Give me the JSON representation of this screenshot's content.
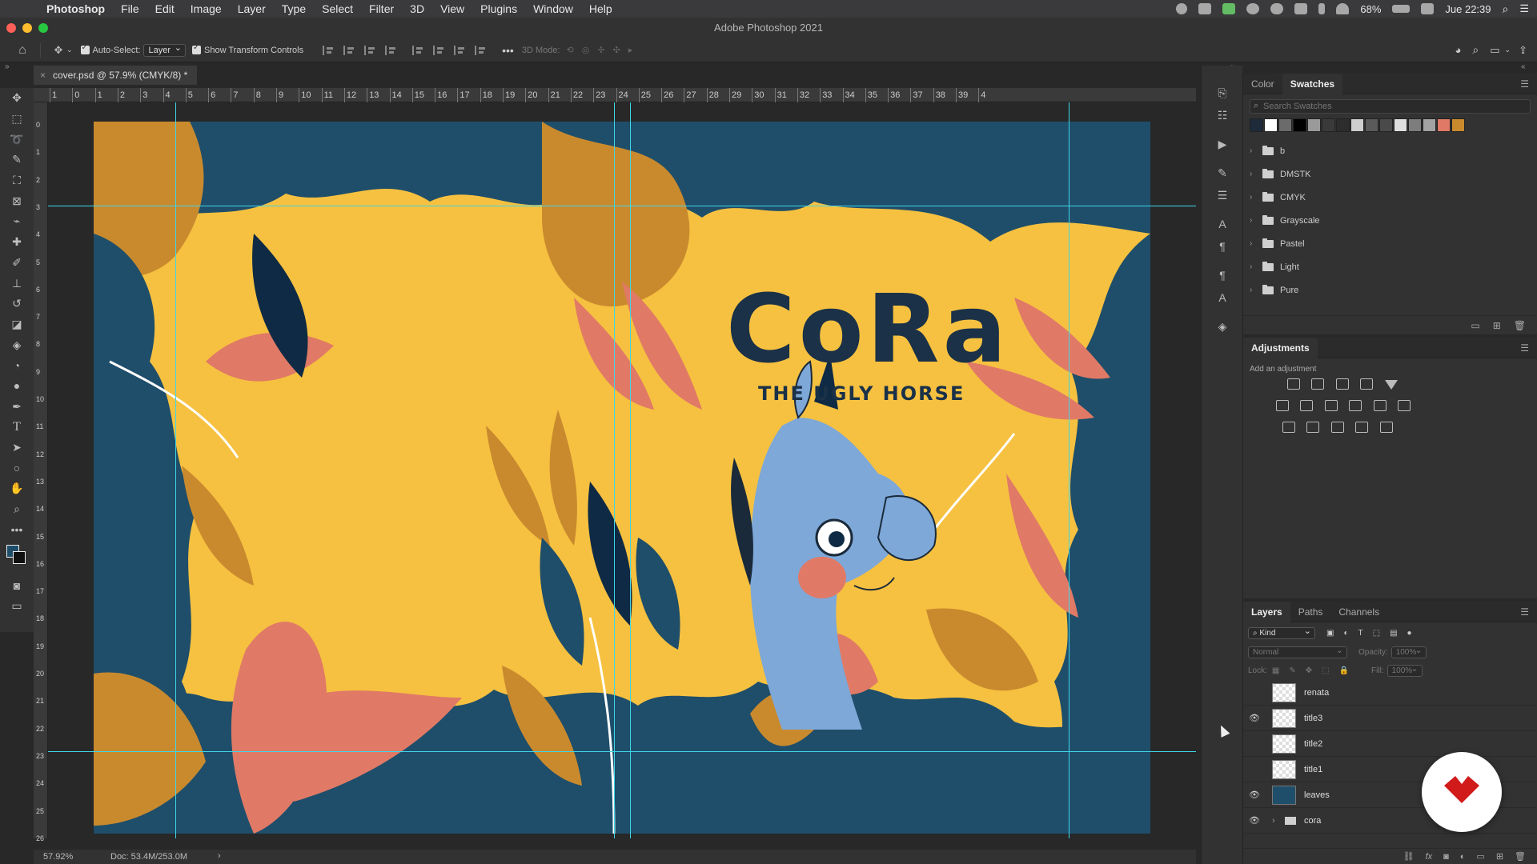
{
  "menubar": {
    "app": "Photoshop",
    "items": [
      "File",
      "Edit",
      "Image",
      "Layer",
      "Type",
      "Select",
      "Filter",
      "3D",
      "View",
      "Plugins",
      "Window",
      "Help"
    ],
    "battery": "68%",
    "clock": "Jue 22:39"
  },
  "window": {
    "title": "Adobe Photoshop 2021"
  },
  "options": {
    "auto_select_label": "Auto-Select:",
    "auto_select_value": "Layer",
    "transform_label": "Show Transform Controls",
    "mode_3d": "3D Mode:"
  },
  "document": {
    "tab_label": "cover.psd @ 57.9% (CMYK/8) *",
    "zoom": "57.92%",
    "doc_size": "Doc: 53.4M/253.0M"
  },
  "rulers": {
    "top": [
      "1",
      "0",
      "1",
      "2",
      "3",
      "4",
      "5",
      "6",
      "7",
      "8",
      "9",
      "10",
      "11",
      "12",
      "13",
      "14",
      "15",
      "16",
      "17",
      "18",
      "19",
      "20",
      "21",
      "22",
      "23",
      "24",
      "25",
      "26",
      "27",
      "28",
      "29",
      "30",
      "31",
      "32",
      "33",
      "34",
      "35",
      "36",
      "37",
      "38",
      "39",
      "4"
    ],
    "left": [
      "0",
      "1",
      "2",
      "3",
      "4",
      "5",
      "6",
      "7",
      "8",
      "9",
      "10",
      "11",
      "12",
      "13",
      "14",
      "15",
      "16",
      "17",
      "18",
      "19",
      "20",
      "21",
      "22",
      "23",
      "24",
      "25",
      "26"
    ]
  },
  "artwork": {
    "title": "CoRa",
    "subtitle": "THE UGLY HORSE"
  },
  "colors": {
    "bg_yellow": "#f6c140",
    "teal": "#1f4e6a",
    "navy": "#0f2a44",
    "ochre": "#c98a2e",
    "coral": "#e07a66",
    "horse_blue": "#7ea8d8",
    "guide": "#3fd6e8"
  },
  "swatches_panel": {
    "tabs": [
      "Color",
      "Swatches"
    ],
    "active_tab": "Swatches",
    "search_placeholder": "Search Swatches",
    "recent": [
      "#1d2b3a",
      "#ffffff",
      "#6b6b6b",
      "#000000",
      "#9a9a9a",
      "#3a3a3a",
      "#2d2d2d",
      "#cfcfcf",
      "#5a5a5a",
      "#4a4a4a",
      "#dedede",
      "#7d7d7d",
      "#a3a3a3",
      "#e07a66",
      "#c98a2e"
    ],
    "groups": [
      "b",
      "DMSTK",
      "CMYK",
      "Grayscale",
      "Pastel",
      "Light",
      "Pure"
    ]
  },
  "adjustments_panel": {
    "title": "Adjustments",
    "hint": "Add an adjustment"
  },
  "layers_panel": {
    "tabs": [
      "Layers",
      "Paths",
      "Channels"
    ],
    "active_tab": "Layers",
    "filter": "Kind",
    "blend_mode": "Normal",
    "opacity_label": "Opacity:",
    "opacity_value": "100%",
    "lock_label": "Lock:",
    "fill_label": "Fill:",
    "fill_value": "100%",
    "layers": [
      {
        "name": "renata",
        "visible": false
      },
      {
        "name": "title3",
        "visible": true
      },
      {
        "name": "title2",
        "visible": false
      },
      {
        "name": "title1",
        "visible": false
      },
      {
        "name": "leaves",
        "visible": true
      },
      {
        "name": "cora",
        "visible": true,
        "group": true
      }
    ]
  }
}
